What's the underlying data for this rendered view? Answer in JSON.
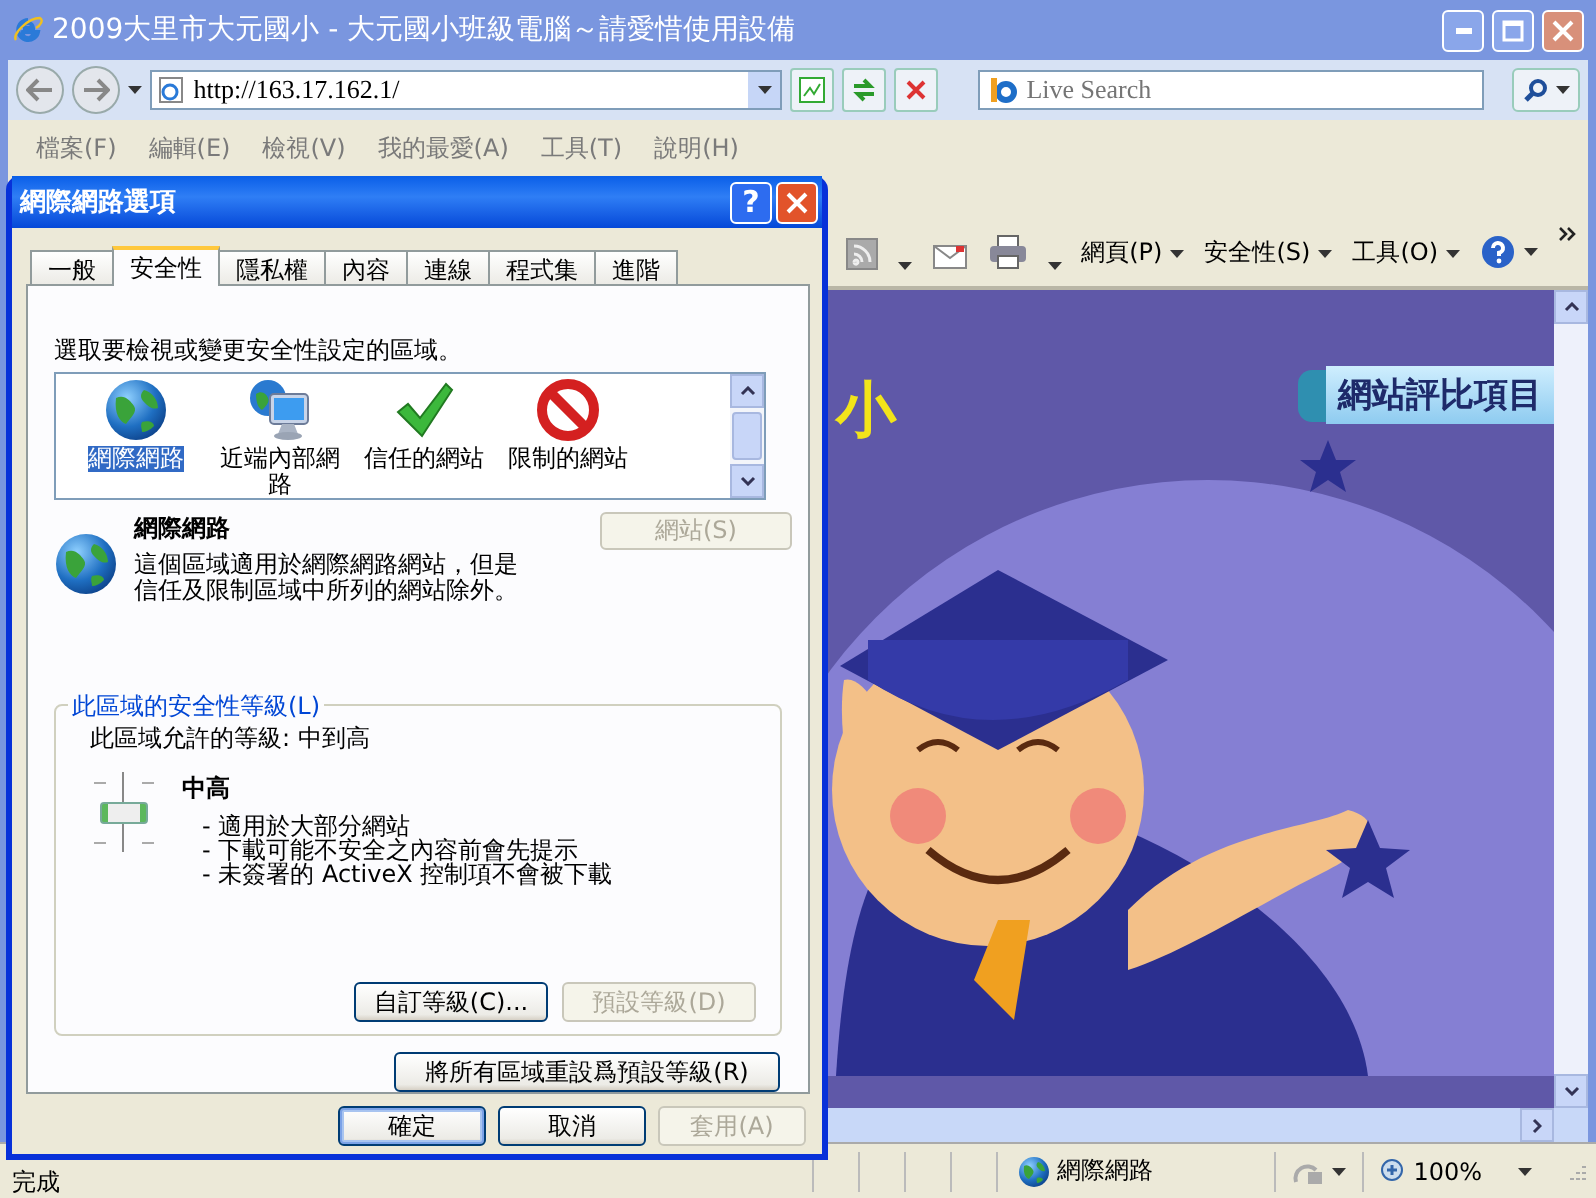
{
  "browser": {
    "title": "2009大里市大元國小 - 大元國小班級電腦～請愛惜使用設備",
    "address": "http://163.17.162.1/",
    "search_placeholder": "Live Search",
    "menu": [
      "檔案(F)",
      "編輯(E)",
      "檢視(V)",
      "我的最愛(A)",
      "工具(T)",
      "說明(H)"
    ],
    "command_bar": [
      "網頁(P)",
      "安全性(S)",
      "工具(O)"
    ],
    "page": {
      "title_fragment": "小",
      "nav_button": "網站評比項目"
    },
    "status": {
      "text": "完成",
      "zone": "網際網路",
      "zoom": "100%"
    }
  },
  "dialog": {
    "title": "網際網路選項",
    "help_button": "?",
    "tabs": [
      {
        "label": "一般",
        "selected": false
      },
      {
        "label": "安全性",
        "selected": true
      },
      {
        "label": "隱私權",
        "selected": false
      },
      {
        "label": "內容",
        "selected": false
      },
      {
        "label": "連線",
        "selected": false
      },
      {
        "label": "程式集",
        "selected": false
      },
      {
        "label": "進階",
        "selected": false
      }
    ],
    "prompt": "選取要檢視或變更安全性設定的區域。",
    "zones": [
      {
        "label": "網際網路",
        "kind": "globe",
        "selected": true
      },
      {
        "label": "近端內部網路",
        "kind": "network",
        "selected": false
      },
      {
        "label": "信任的網站",
        "kind": "check",
        "selected": false
      },
      {
        "label": "限制的網站",
        "kind": "blocked",
        "selected": false
      }
    ],
    "zone_name": "網際網路",
    "zone_description": "這個區域適用於網際網路網站，但是信任及限制區域中所列的網站除外。",
    "sites_button": {
      "label": "網站(S)",
      "disabled": true
    },
    "level_group": {
      "title": "此區域的安全性等級(L)",
      "allowed": "此區域允許的等級: 中到高",
      "level": 0.5,
      "level_name": "中高",
      "bullets": [
        "- 適用於大部分網站",
        "- 下載可能不安全之內容前會先提示",
        "- 未簽署的 ActiveX 控制項不會被下載"
      ],
      "buttons": [
        {
          "label": "自訂等級(C)...",
          "disabled": false
        },
        {
          "label": "預設等級(D)",
          "disabled": true
        }
      ]
    },
    "reset_button": "將所有區域重設爲預設等級(R)",
    "buttons": [
      {
        "label": "確定",
        "disabled": false,
        "default": true
      },
      {
        "label": "取消",
        "disabled": false,
        "default": false
      },
      {
        "label": "套用(A)",
        "disabled": true,
        "default": false
      }
    ]
  }
}
